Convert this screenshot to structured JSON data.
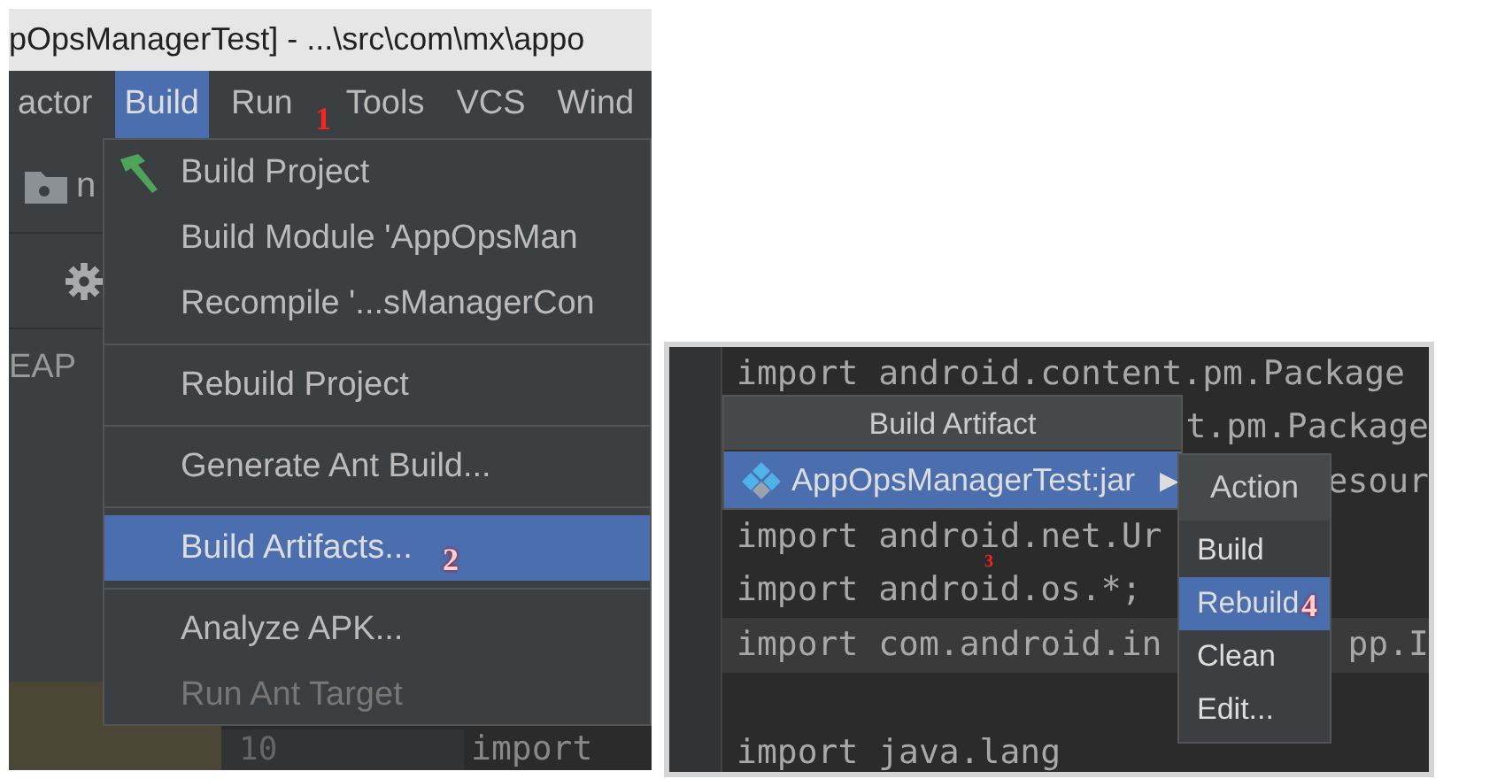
{
  "window": {
    "title": "pOpsManagerTest] - ...\\src\\com\\mx\\appo"
  },
  "menu_bar": [
    {
      "label": "actor",
      "selected": false
    },
    {
      "label": "Build",
      "selected": true
    },
    {
      "label": "Run",
      "selected": false
    },
    {
      "label": "Tools",
      "selected": false
    },
    {
      "label": "VCS",
      "selected": false
    },
    {
      "label": "Wind",
      "selected": false
    }
  ],
  "sidebar": [
    {
      "kind": "folder",
      "label": "n"
    },
    {
      "kind": "gear"
    },
    {
      "kind": "text",
      "label": "EAP"
    }
  ],
  "build_menu": {
    "groups": [
      [
        {
          "kind": "hammer",
          "label": "Build Project",
          "selected": false,
          "disabled": false
        },
        {
          "kind": "plain",
          "label": "Build Module 'AppOpsMan",
          "selected": false,
          "disabled": false
        },
        {
          "kind": "plain",
          "label": "Recompile '...sManagerCon",
          "selected": false,
          "disabled": false
        }
      ],
      [
        {
          "kind": "plain",
          "label": "Rebuild Project",
          "selected": false,
          "disabled": false
        }
      ],
      [
        {
          "kind": "plain",
          "label": "Generate Ant Build...",
          "selected": false,
          "disabled": false
        }
      ],
      [
        {
          "kind": "plain",
          "label": "Build Artifacts...",
          "selected": true,
          "disabled": false
        }
      ],
      [
        {
          "kind": "plain",
          "label": "Analyze APK...",
          "selected": false,
          "disabled": false
        },
        {
          "kind": "plain",
          "label": "Run Ant Target",
          "selected": false,
          "disabled": true
        }
      ]
    ]
  },
  "editor_strip": {
    "line_number": "10",
    "code": "import"
  },
  "code_lines": [
    {
      "left": "import android.content.pm.Package",
      "current": false
    },
    {
      "right": "t.pm.Package",
      "current": false
    },
    {
      "right": "esour",
      "current": false
    },
    {
      "left": "import android.net.Ur",
      "current": false
    },
    {
      "left": "import android.os.*;",
      "current": false
    },
    {
      "left": "import com.android.in",
      "right": "pp.I",
      "current": true
    },
    {
      "current": false
    },
    {
      "left": "import java.lang",
      "current": false
    }
  ],
  "artifact_popup": {
    "title": "Build Artifact",
    "items": [
      {
        "label": "AppOpsManagerTest:jar",
        "submenu": "▶",
        "selected": true
      }
    ]
  },
  "action_popup": {
    "title": "Action",
    "items": [
      {
        "label": "Build",
        "selected": false
      },
      {
        "label": "Rebuild",
        "selected": true
      },
      {
        "label": "Clean",
        "selected": false
      },
      {
        "label": "Edit...",
        "selected": false
      }
    ]
  },
  "annotations": [
    "1",
    "2",
    "3",
    "4"
  ]
}
